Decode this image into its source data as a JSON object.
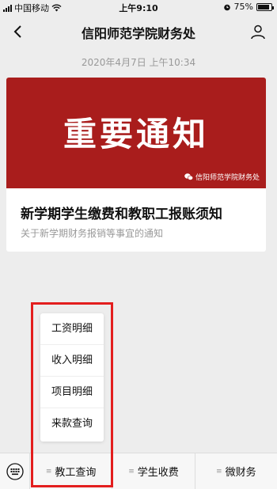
{
  "status_bar": {
    "carrier": "中国移动",
    "time": "上午9:10",
    "battery": "75%"
  },
  "nav": {
    "title": "信阳师范学院财务处"
  },
  "timestamp": "2020年4月7日 上午10:34",
  "article": {
    "banner_text": "重要通知",
    "banner_source": "信阳师范学院财务处",
    "title": "新学期学生缴费和教职工报账须知",
    "description": "关于新学期财务报销等事宜的通知"
  },
  "popup_menu": {
    "items": [
      "工资明细",
      "收入明细",
      "项目明细",
      "来款查询"
    ]
  },
  "bottom_menu": {
    "items": [
      "教工查询",
      "学生收费",
      "微财务"
    ]
  },
  "colors": {
    "banner": "#a91d1c",
    "highlight": "#e31e1e",
    "background": "#ededed"
  }
}
